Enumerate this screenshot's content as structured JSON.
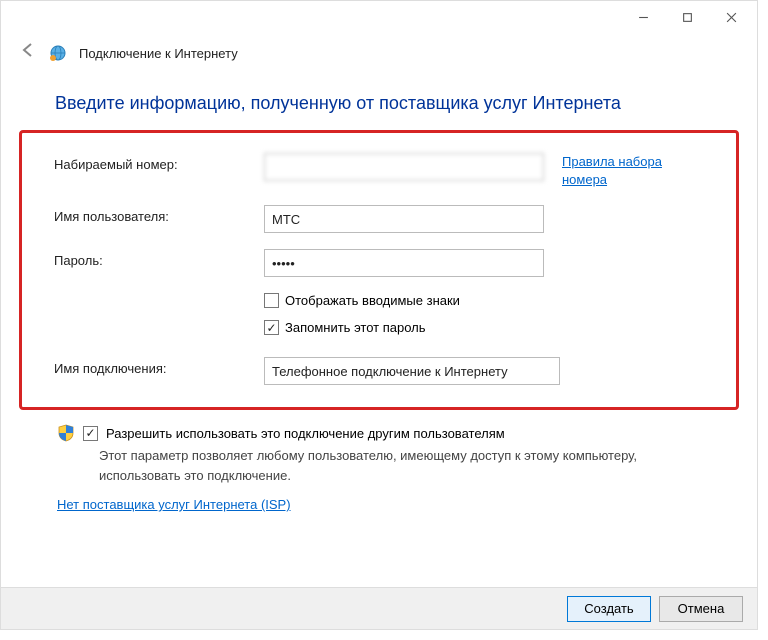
{
  "titlebar": {
    "minimize": "–",
    "maximize": "□",
    "close": "✕"
  },
  "header": {
    "title": "Подключение к Интернету"
  },
  "page": {
    "title": "Введите информацию, полученную от поставщика услуг Интернета"
  },
  "form": {
    "dial_number_label": "Набираемый номер:",
    "dial_number_value": "",
    "dialing_rules_link": "Правила набора номера",
    "username_label": "Имя пользователя:",
    "username_value": "МТС",
    "password_label": "Пароль:",
    "password_value": "•••••",
    "show_chars_label": "Отображать вводимые знаки",
    "remember_password_label": "Запомнить этот пароль",
    "connection_name_label": "Имя подключения:",
    "connection_name_value": "Телефонное подключение к Интернету"
  },
  "allow": {
    "label": "Разрешить использовать это подключение другим пользователям",
    "hint": "Этот параметр позволяет любому пользователю, имеющему доступ к этому компьютеру, использовать это подключение."
  },
  "isp_link": "Нет поставщика услуг Интернета (ISP)",
  "buttons": {
    "create": "Создать",
    "cancel": "Отмена"
  }
}
